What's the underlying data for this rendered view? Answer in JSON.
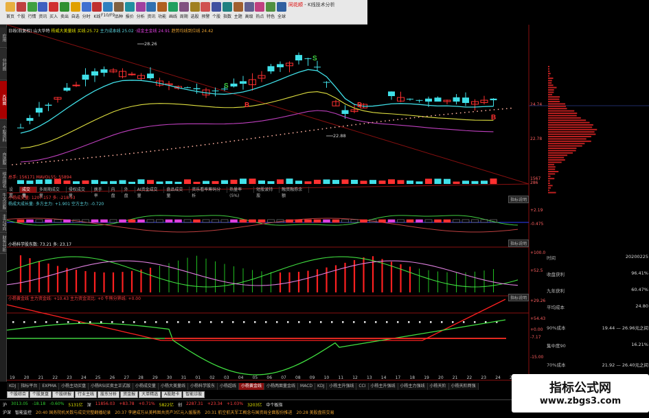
{
  "toolbar": {
    "buttons": [
      "首页",
      "个股",
      "行情",
      "资讯",
      "买入",
      "卖出",
      "自选",
      "分时",
      "K线",
      "F10/F9",
      "品种",
      "报价",
      "分析",
      "资讯",
      "功能",
      "画线",
      "周期",
      "选股",
      "预警",
      "个股",
      "指数",
      "主题",
      "高级",
      "热点",
      "特色",
      "全球"
    ],
    "title_logo": "同花顺",
    "title_suffix": " - K线技术分析"
  },
  "leftbar": {
    "tabs": [
      "应用",
      "分时图",
      "K线图",
      "个股资料",
      "自选股",
      "综合排名",
      "牛叉诊股",
      "主力动向",
      "财务分析"
    ],
    "active": 2
  },
  "kline": {
    "info_prefix": "日线(前复权)",
    "stock_name": "山大华特",
    "items": [
      {
        "label": "杨威大美量线",
        "value": "买线:25.72",
        "color": "yel"
      },
      {
        "label": "主力成本线",
        "value": "25.02",
        "color": "cyn"
      },
      {
        "label": "·成金主金线",
        "value": "24.91",
        "color": "mag"
      },
      {
        "label": "趋势均线到位线",
        "value": "24.42",
        "color": "org"
      }
    ],
    "high_label": "28.26",
    "low_label": "22.88",
    "signals": [
      "S",
      "S",
      "B",
      "B",
      "B"
    ],
    "price_axis": [
      "24.74",
      "22.78"
    ]
  },
  "volume": {
    "info": "总手: 156171  MAVOL55: 55894",
    "axis": [
      "1567",
      "286"
    ]
  },
  "indicator_tabs": [
    "设置",
    "成交量",
    "多周期成交量",
    "侵权成交量",
    "换手率",
    "内盘",
    "外盘",
    "AI资金成交量",
    "盘品成交量",
    "资乐看率筹码分析",
    "热量率(5%)",
    "短股波持股",
    "融资融券余额"
  ],
  "indicator_tabs_active": 1,
  "panel1": {
    "title": "小杨成交量",
    "line2": "杨成大成长量: 多方主力: +1.901  空方主力: -0.720",
    "line1": "小杨成交量: 1207.157  多: -218.53",
    "axis": [
      "+2.19",
      "-0.475"
    ],
    "help": "指标说明"
  },
  "panel2": {
    "title": "小杨科学股东",
    "info": "小杨科学股东数: 73.21  多: 23.17",
    "axis": [
      "+100.0",
      "+52.5"
    ],
    "help": "指标说明"
  },
  "panel3": {
    "title": "小杨黄金线",
    "info": "小杨黄金线 主力资金线: +10.43  主力资金流比: +0  牛熊分界线: +0.00",
    "axis": [
      "+29.26",
      "+54.43",
      "+0.00",
      "-7.17",
      "-15.00",
      "-17.80"
    ],
    "help": "指标说明"
  },
  "right_info": {
    "rows": [
      {
        "label": "时间",
        "value": "20200225"
      },
      {
        "label": "收盘获利",
        "value": "96.41%"
      },
      {
        "label": "九年获利",
        "value": "60.47%"
      },
      {
        "label": "平均成本",
        "value": "24.80"
      },
      {
        "label": "90%成本",
        "value": "19.44 — 26.96元之间"
      },
      {
        "label": "集中度90",
        "value": "16.21%"
      },
      {
        "label": "70%成本",
        "value": "21.92 — 26.40元之间"
      }
    ]
  },
  "x_axis": [
    "19",
    "20",
    "21",
    "22",
    "23",
    "24",
    "25",
    "26",
    "27",
    "28",
    "29",
    "30",
    "31",
    "01",
    "02",
    "03",
    "04",
    "05",
    "06",
    "07",
    "08",
    "09",
    "10",
    "11",
    "12",
    "13",
    "14",
    "17",
    "18",
    "19",
    "20",
    "21",
    "22",
    "23",
    "24",
    "25"
  ],
  "bottom_tabs": [
    "KDJ",
    "指标平台",
    "EXPMA",
    "小杨主动买盘",
    "小杨RSI买卖主正式版",
    "小杨成交量",
    "小杨大美量线",
    "小杨科学股东",
    "小杨超线",
    "小杨黄金线",
    "小杨两面量金线",
    "MACD",
    "KDJ",
    "小杨主升强线",
    "CCI",
    "小杨主升强线",
    "小杨主力强线",
    "小杨天阶",
    "小杨天阶两强"
  ],
  "bottom_tab_active": 9,
  "bottom_tabs2": [
    "个股综合",
    "个股复盘",
    "个股研报",
    "行业主线",
    "股东分析",
    "资金报",
    "大单精选",
    "A股题卡",
    "智能诊股"
  ],
  "status": {
    "row1": [
      {
        "t": "沪",
        "c": "wht"
      },
      {
        "t": "3013.05",
        "c": "grn"
      },
      {
        "t": "-18.18",
        "c": "grn"
      },
      {
        "t": "-0.60%",
        "c": "grn"
      },
      {
        "t": "5131亿",
        "c": "yel"
      },
      {
        "t": "深",
        "c": "wht"
      },
      {
        "t": "11856.03",
        "c": "red"
      },
      {
        "t": "+83.78",
        "c": "red"
      },
      {
        "t": "+0.71%",
        "c": "red"
      },
      {
        "t": "5822亿",
        "c": "yel"
      },
      {
        "t": "创",
        "c": "wht"
      },
      {
        "t": "2287.31",
        "c": "red"
      },
      {
        "t": "+23.34",
        "c": "red"
      },
      {
        "t": "+1.03%",
        "c": "red"
      },
      {
        "t": "3203亿",
        "c": "yel"
      },
      {
        "t": "中个板指",
        "c": "wht"
      }
    ],
    "row2": [
      {
        "t": "沪深",
        "c": "wht"
      },
      {
        "t": "智能监控",
        "c": "wht"
      },
      {
        "t": "20:40 国务院机关数与成交完整翻播纪录",
        "c": "org"
      },
      {
        "t": "20:37 李建成万从美韩图共资产3亿元入援服务",
        "c": "org"
      },
      {
        "t": "20:31 航空航天军工概念与国资局全面股份推进",
        "c": "org"
      },
      {
        "t": "20:28 美股盘前交易",
        "c": "org"
      }
    ]
  },
  "watermark": {
    "line1": "指标公式网",
    "line2": "www.zbgs3.com"
  },
  "colors": {
    "up": "#ff3030",
    "down": "#40e0e8",
    "ma1": "#40e0e8",
    "ma2": "#e0e040",
    "ma3": "#c040c0",
    "dot": "#ffb0a0"
  }
}
